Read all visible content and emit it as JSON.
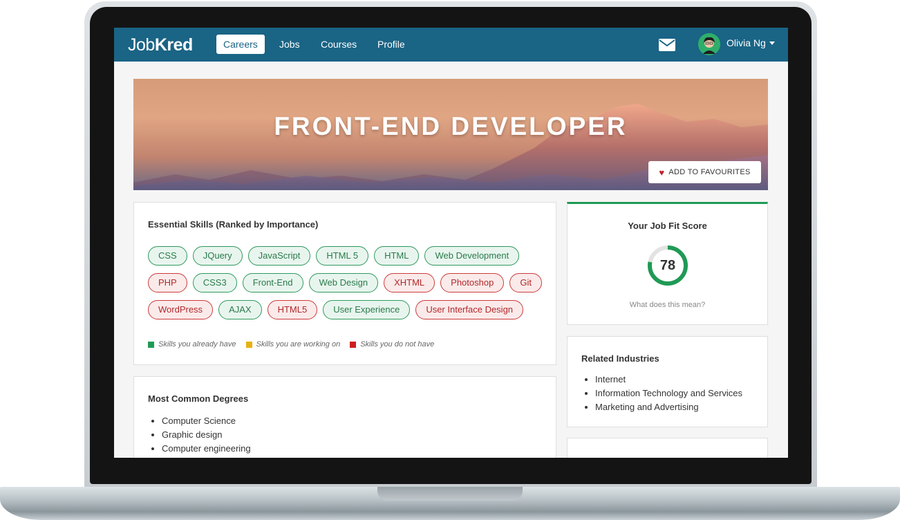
{
  "nav": {
    "logo_light": "Job",
    "logo_bold": "Kred",
    "items": [
      {
        "label": "Careers",
        "active": true
      },
      {
        "label": "Jobs",
        "active": false
      },
      {
        "label": "Courses",
        "active": false
      },
      {
        "label": "Profile",
        "active": false
      }
    ],
    "user_name": "Olivia Ng"
  },
  "hero": {
    "title": "FRONT-END DEVELOPER",
    "favourite_label": "ADD TO FAVOURITES"
  },
  "skills": {
    "title": "Essential Skills (Ranked by Importance)",
    "rows": [
      [
        {
          "label": "CSS",
          "status": "have"
        },
        {
          "label": "JQuery",
          "status": "have"
        },
        {
          "label": "JavaScript",
          "status": "have"
        },
        {
          "label": "HTML 5",
          "status": "have"
        },
        {
          "label": "HTML",
          "status": "have"
        },
        {
          "label": "Web Development",
          "status": "have"
        }
      ],
      [
        {
          "label": "PHP",
          "status": "missing"
        },
        {
          "label": "CSS3",
          "status": "have"
        },
        {
          "label": "Front-End",
          "status": "have"
        },
        {
          "label": "Web Design",
          "status": "have"
        },
        {
          "label": "XHTML",
          "status": "missing"
        },
        {
          "label": "Photoshop",
          "status": "missing"
        },
        {
          "label": "Git",
          "status": "missing"
        }
      ],
      [
        {
          "label": "WordPress",
          "status": "missing"
        },
        {
          "label": "AJAX",
          "status": "have"
        },
        {
          "label": "HTML5",
          "status": "missing"
        },
        {
          "label": "User Experience",
          "status": "have"
        },
        {
          "label": "User Interface Design",
          "status": "missing"
        }
      ]
    ],
    "legend": [
      {
        "label": "Skills you already have",
        "color": "#1f9a55"
      },
      {
        "label": "Skills you are working on",
        "color": "#e8b10e"
      },
      {
        "label": "Skills you do not have",
        "color": "#cc1f1f"
      }
    ]
  },
  "degrees": {
    "title": "Most Common Degrees",
    "items": [
      "Computer Science",
      "Graphic design",
      "Computer engineering"
    ]
  },
  "job_fit": {
    "title": "Your Job Fit Score",
    "score": 78,
    "link": "What does this mean?",
    "accent_color": "#1f9a55"
  },
  "industries": {
    "title": "Related Industries",
    "items": [
      "Internet",
      "Information Technology and Services",
      "Marketing and Advertising"
    ]
  },
  "colors": {
    "nav_bg": "#1a6485",
    "have_border": "#2e9a5c",
    "missing_border": "#cc3b3b"
  }
}
